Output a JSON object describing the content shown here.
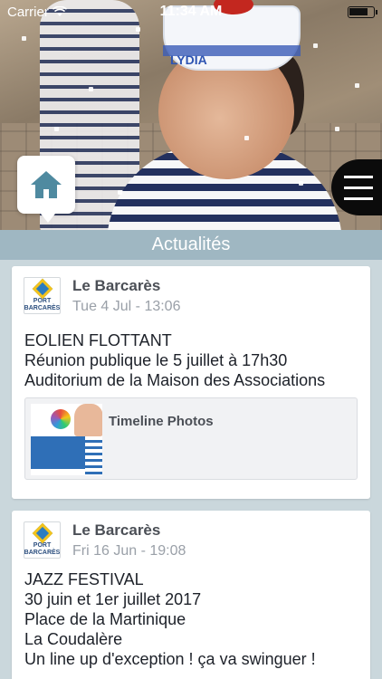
{
  "status_bar": {
    "carrier": "Carrier",
    "time": "11:34 AM",
    "battery_level": 0.8
  },
  "hero": {
    "hat_text": "LYDIA"
  },
  "home_button": {
    "icon": "home-icon"
  },
  "menu_button": {
    "icon": "hamburger-menu-icon"
  },
  "section": {
    "title": "Actualités"
  },
  "feed": {
    "posts": [
      {
        "author": "Le Barcarès",
        "date": "Tue 4 Jul - 13:06",
        "logo_text": "PORT\nBARCARÈS",
        "text": "EOLIEN FLOTTANT\nRéunion publique le 5 juillet à 17h30\nAuditorium de la Maison des Associations",
        "attachment": {
          "title": "Timeline Photos"
        }
      },
      {
        "author": "Le Barcarès",
        "date": "Fri 16 Jun - 19:08",
        "logo_text": "PORT\nBARCARÈS",
        "text": "JAZZ FESTIVAL\n30 juin et 1er juillet 2017\nPlace de la Martinique\nLa Coudalère\nUn line up d'exception ! ça va swinguer !"
      }
    ]
  }
}
